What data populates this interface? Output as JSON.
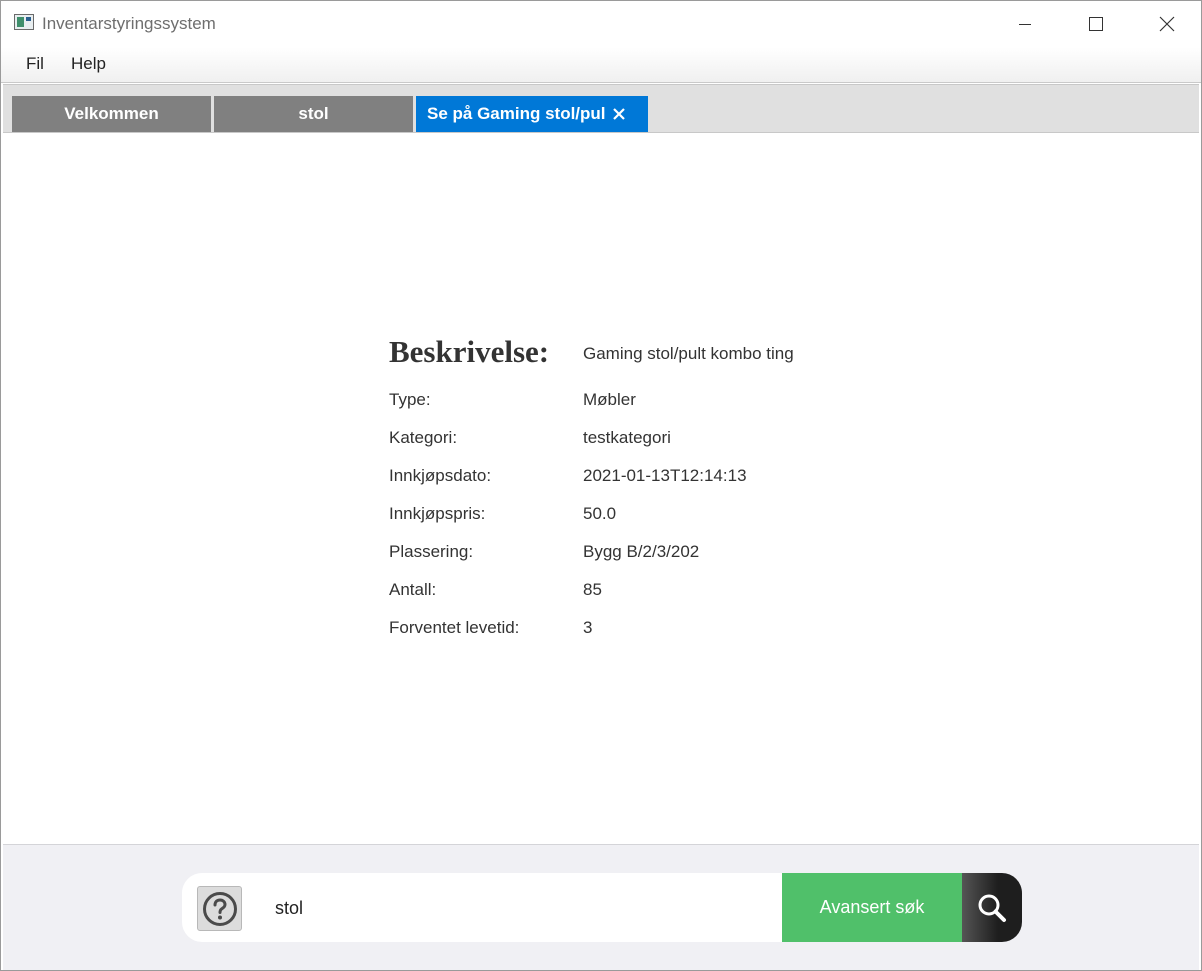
{
  "window": {
    "title": "Inventarstyringssystem",
    "icon": "app-icon"
  },
  "menu": {
    "items": [
      {
        "label": "Fil"
      },
      {
        "label": "Help"
      }
    ]
  },
  "tabs": [
    {
      "label": "Velkommen",
      "active": false
    },
    {
      "label": "stol",
      "active": false
    },
    {
      "label": "Se på Gaming stol/pul",
      "active": true,
      "closable": true
    }
  ],
  "colors": {
    "active_tab": "#0078d7",
    "inactive_tab": "#808080",
    "advanced_search": "#50c06a"
  },
  "details": {
    "description_label": "Beskrivelse:",
    "description_value": "Gaming stol/pult kombo ting",
    "fields": [
      {
        "label": "Type:",
        "value": "Møbler"
      },
      {
        "label": "Kategori:",
        "value": "testkategori"
      },
      {
        "label": "Innkjøpsdato:",
        "value": "2021-01-13T12:14:13"
      },
      {
        "label": "Innkjøpspris:",
        "value": "50.0"
      },
      {
        "label": "Plassering:",
        "value": "Bygg B/2/3/202"
      },
      {
        "label": "Antall:",
        "value": "85"
      },
      {
        "label": "Forventet levetid:",
        "value": "3"
      }
    ]
  },
  "search": {
    "value": "stol",
    "advanced_label": "Avansert søk",
    "help_icon": "question-icon",
    "search_icon": "search-icon"
  }
}
